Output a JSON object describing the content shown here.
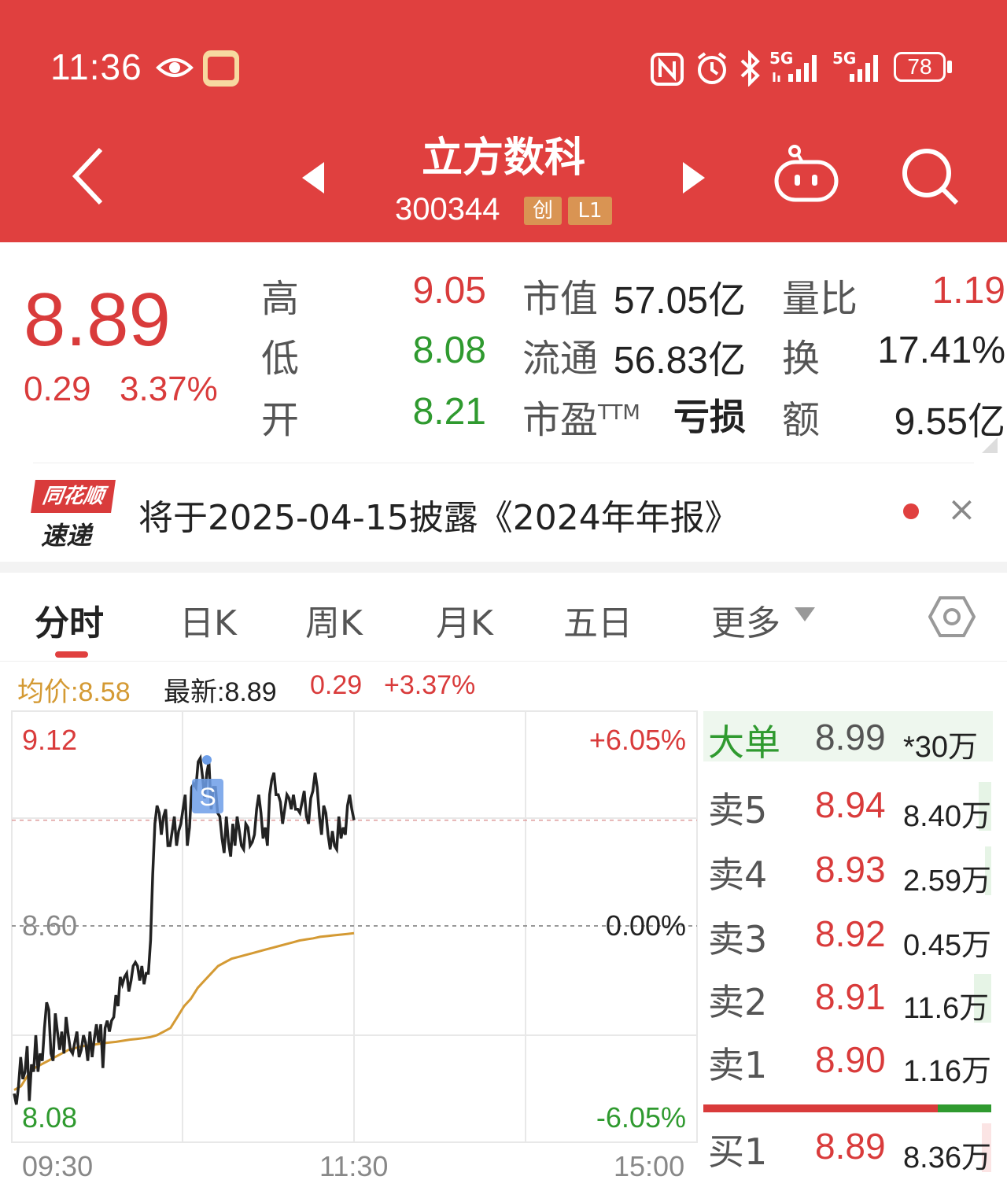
{
  "status_bar": {
    "time": "11:36",
    "network1": "5G",
    "network2": "5G",
    "battery": "78"
  },
  "header": {
    "title": "立方数科",
    "code": "300344",
    "tag1": "创",
    "tag2": "L1"
  },
  "quote": {
    "price": "8.89",
    "change": "0.29",
    "change_pct": "3.37%",
    "rows": [
      {
        "l1": "高",
        "v1": "9.05",
        "l2": "市值",
        "v2": "57.05亿",
        "l3": "量比",
        "v3": "1.19"
      },
      {
        "l1": "低",
        "v1": "8.08",
        "l2": "流通",
        "v2": "56.83亿",
        "l3": "换",
        "v3": "17.41%"
      },
      {
        "l1": "开",
        "v1": "8.21",
        "l2": "市盈",
        "l2sup": "TTM",
        "v2": "亏损",
        "l3": "额",
        "v3": "9.55亿"
      }
    ]
  },
  "news": {
    "logo_top": "同花顺",
    "logo_bottom": "速递",
    "text": "将于2025-04-15披露《2024年年报》",
    "close": "×"
  },
  "tabs": [
    "分时",
    "日K",
    "周K",
    "月K",
    "五日",
    "更多"
  ],
  "legend": {
    "avg_label": "均价:8.58",
    "latest_label": "最新:8.89",
    "change": "0.29",
    "change_pct": "+3.37%"
  },
  "chart_labels": {
    "y_top": "9.12",
    "y_mid": "8.60",
    "y_bottom": "8.08",
    "pct_top": "+6.05%",
    "pct_mid": "0.00%",
    "pct_bottom": "-6.05%",
    "x_start": "09:30",
    "x_mid": "11:30",
    "x_end": "15:00",
    "marker": "S"
  },
  "orderbook": {
    "big_order": {
      "label": "大单",
      "price": "8.99",
      "vol": "*30万"
    },
    "levels": [
      {
        "label": "卖5",
        "price": "8.94",
        "vol": "8.40万"
      },
      {
        "label": "卖4",
        "price": "8.93",
        "vol": "2.59万"
      },
      {
        "label": "卖3",
        "price": "8.92",
        "vol": "0.45万"
      },
      {
        "label": "卖2",
        "price": "8.91",
        "vol": "11.6万"
      },
      {
        "label": "卖1",
        "price": "8.90",
        "vol": "1.16万"
      },
      {
        "label": "买1",
        "price": "8.89",
        "vol": "8.36万"
      }
    ]
  },
  "chart_data": {
    "type": "line",
    "ylim": [
      8.08,
      9.12
    ],
    "prev_close": 8.6,
    "x_ticks": [
      "09:30",
      "11:30",
      "15:00"
    ],
    "series": [
      {
        "values": [
          8.14,
          8.11,
          8.16,
          8.24,
          8.18,
          8.2,
          8.27,
          8.12,
          8.22,
          8.2,
          8.3,
          8.2,
          8.25,
          8.23,
          8.32,
          8.39,
          8.37,
          8.25,
          8.23,
          8.36,
          8.31,
          8.26,
          8.31,
          8.25,
          8.35,
          8.3,
          8.26,
          8.25,
          8.28,
          8.31,
          8.24,
          8.26,
          8.3,
          8.28,
          8.23,
          8.31,
          8.24,
          8.29,
          8.33,
          8.28,
          8.33,
          8.21,
          8.32,
          8.34,
          8.31,
          8.34,
          8.35,
          8.41,
          8.38,
          8.46,
          8.44,
          8.46,
          8.47,
          8.42,
          8.45,
          8.49,
          8.5,
          8.49,
          8.45,
          8.49,
          8.44,
          8.47,
          8.47,
          8.56,
          8.74,
          8.88,
          8.93,
          8.91,
          8.85,
          8.9,
          8.92,
          8.82,
          8.82,
          8.86,
          8.9,
          8.82,
          8.86,
          8.88,
          8.92,
          8.96,
          8.82,
          8.87,
          8.98,
          8.99,
          8.98,
          9.05,
          9.06,
          9.01,
          8.95,
          9.02,
          9.05,
          8.92,
          8.98,
          8.98,
          8.91,
          8.9,
          8.84,
          8.8,
          8.9,
          8.83,
          8.79,
          8.88,
          8.82,
          8.9,
          8.86,
          8.82,
          8.81,
          8.88,
          8.87,
          8.82,
          8.83,
          8.85,
          8.92,
          8.96,
          8.91,
          8.84,
          8.87,
          8.82,
          8.96,
          9.0,
          9.02,
          8.96,
          8.96,
          8.94,
          8.88,
          8.92,
          8.96,
          8.95,
          8.92,
          8.96,
          8.92,
          8.92,
          8.91,
          8.94,
          8.97,
          8.9,
          8.88,
          8.95,
          8.97,
          9.02,
          8.98,
          8.9,
          8.85,
          8.93,
          8.91,
          8.85,
          8.81,
          8.86,
          8.82,
          8.81,
          8.9,
          8.84,
          8.87,
          8.85,
          8.93,
          8.96,
          8.92,
          8.89
        ]
      },
      {
        "values": [
          8.15,
          8.16,
          8.19,
          8.21,
          8.22,
          8.23,
          8.24,
          8.25,
          8.26,
          8.265,
          8.27,
          8.272,
          8.275,
          8.278,
          8.28,
          8.282,
          8.285,
          8.288,
          8.29,
          8.292,
          8.295,
          8.3,
          8.31,
          8.32,
          8.35,
          8.38,
          8.4,
          8.43,
          8.45,
          8.47,
          8.49,
          8.5,
          8.51,
          8.515,
          8.52,
          8.525,
          8.53,
          8.535,
          8.54,
          8.545,
          8.55,
          8.555,
          8.56,
          8.563,
          8.566,
          8.57,
          8.572,
          8.574,
          8.576,
          8.578,
          8.58
        ]
      }
    ]
  }
}
